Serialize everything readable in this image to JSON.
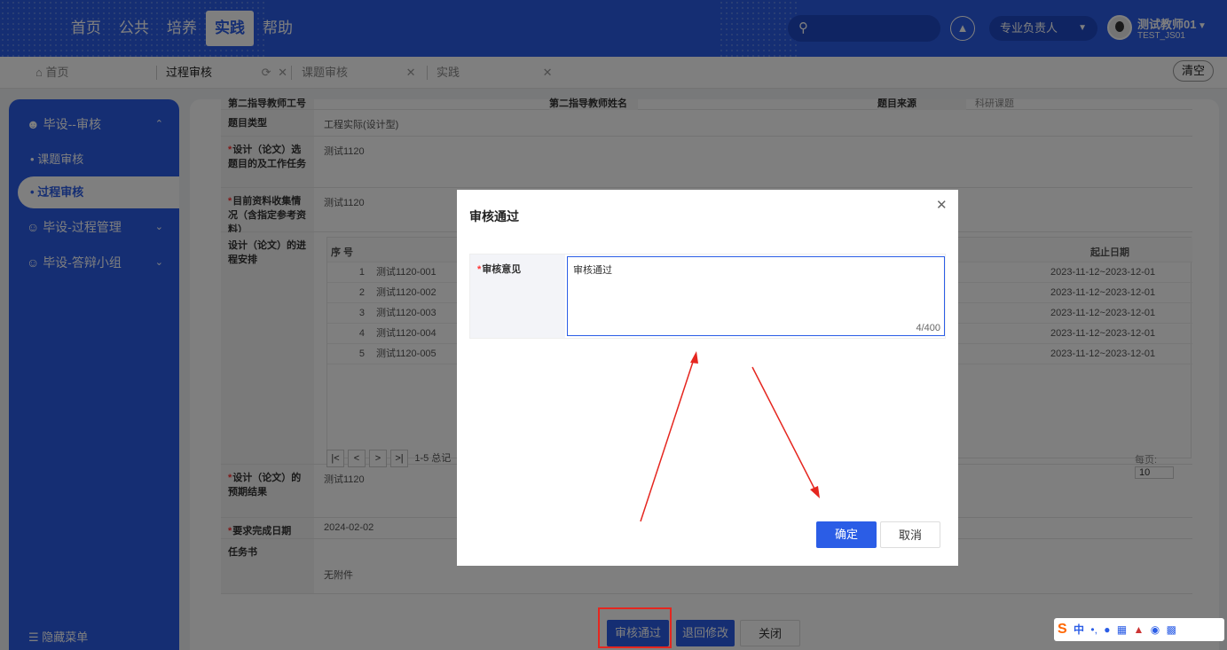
{
  "topnav": {
    "items": [
      "首页",
      "公共",
      "培养",
      "实践",
      "帮助"
    ],
    "active_index": 3
  },
  "header": {
    "role": "专业负责人",
    "user_name": "测试教师01",
    "user_id": "TEST_JS01"
  },
  "tabs": {
    "home": "首页",
    "items": [
      "过程审核",
      "课题审核",
      "实践"
    ],
    "clear": "清空"
  },
  "sidebar": {
    "groups": [
      {
        "label": "毕设--审核",
        "icon": "users-icon",
        "expanded": true
      },
      {
        "label": "毕设-过程管理",
        "icon": "user-group-icon",
        "expanded": false
      },
      {
        "label": "毕设-答辩小组",
        "icon": "user-icon",
        "expanded": false
      }
    ],
    "sub_items": [
      "课题审核",
      "过程审核"
    ],
    "active_sub": "过程审核",
    "hide_menu": "隐藏菜单"
  },
  "form": {
    "row0": {
      "label": "第二指导教师工号",
      "label2": "第二指导教师姓名",
      "label3": "题目来源",
      "value3": "科研课题"
    },
    "topic_type": {
      "label": "题目类型",
      "value": "工程实际(设计型)"
    },
    "purpose": {
      "label": "设计（论文）选题目的及工作任务",
      "value": "测试1120"
    },
    "materials": {
      "label": "目前资料收集情况（含指定参考资料）",
      "value": "测试1120"
    },
    "schedule": {
      "label": "设计（论文）的进程安排",
      "col_no": "序 号",
      "col_date": "起止日期",
      "rows": [
        {
          "no": "1",
          "name": "测试1120-001",
          "date": "2023-11-12~2023-12-01"
        },
        {
          "no": "2",
          "name": "测试1120-002",
          "date": "2023-11-12~2023-12-01"
        },
        {
          "no": "3",
          "name": "测试1120-003",
          "date": "2023-11-12~2023-12-01"
        },
        {
          "no": "4",
          "name": "测试1120-004",
          "date": "2023-11-12~2023-12-01"
        },
        {
          "no": "5",
          "name": "测试1120-005",
          "date": "2023-11-12~2023-12-01"
        }
      ],
      "pager_summary": "1-5 总记",
      "per_page_label": "每页:",
      "per_page_value": "10"
    },
    "expected": {
      "label": "设计（论文）的预期结果",
      "value": "测试1120"
    },
    "deadline": {
      "label": "要求完成日期",
      "value": "2024-02-02"
    },
    "taskbook": {
      "label": "任务书",
      "value": "无附件"
    }
  },
  "footer": {
    "approve": "审核通过",
    "return": "退回修改",
    "close": "关闭"
  },
  "modal": {
    "title": "审核通过",
    "label": "审核意见",
    "value": "审核通过",
    "counter": "4/400",
    "ok": "确定",
    "cancel": "取消"
  },
  "ime": {
    "label": "中"
  }
}
